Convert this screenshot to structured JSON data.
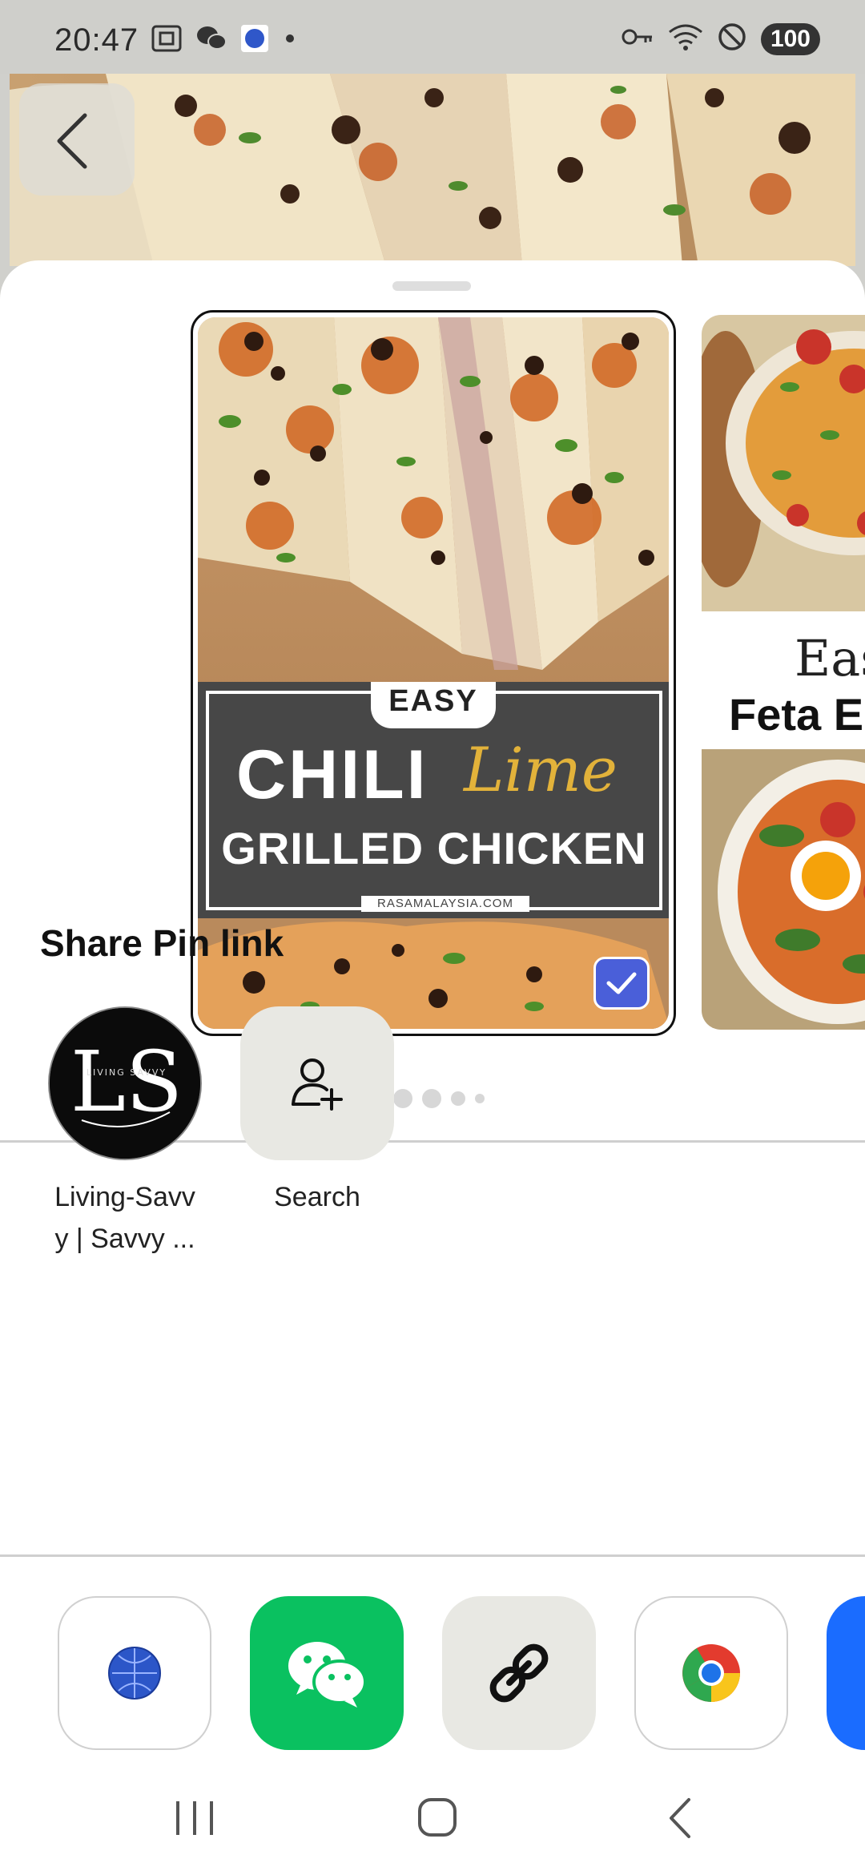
{
  "status_bar": {
    "time": "20:47",
    "battery": "100",
    "left_icons": [
      "screenshot-icon",
      "wechat-icon",
      "app-icon",
      "dot-icon"
    ],
    "right_icons": [
      "key-icon",
      "wifi-icon",
      "dnd-icon"
    ]
  },
  "pin": {
    "badge": "EASY",
    "title_line1": "CHILI",
    "title_script": "Lime",
    "title_line2": "GRILLED CHICKEN",
    "source": "RASAMALAYSIA.COM",
    "selected": true
  },
  "next_pin": {
    "title_top": "Eas",
    "title_bottom": "Feta E"
  },
  "pagination": {
    "total": 5,
    "active": 0
  },
  "share": {
    "title": "Share Pin link",
    "contacts": [
      {
        "label": "Living-Savv\ny | Savvy ...",
        "avatar_text": "LS",
        "avatar_subtext": "LIVING SAVVY"
      },
      {
        "label": "Search",
        "icon": "add-person-icon"
      }
    ]
  },
  "apps": [
    {
      "name": "browser-app",
      "icon": "globe-icon",
      "bg": "#ffffff"
    },
    {
      "name": "wechat",
      "icon": "wechat-icon",
      "bg": "#07c160"
    },
    {
      "name": "copy-link",
      "icon": "link-icon",
      "bg": "#e8e8e3"
    },
    {
      "name": "chrome",
      "icon": "chrome-icon",
      "bg": "#ffffff"
    },
    {
      "name": "more-app",
      "icon": "blue-app-icon",
      "bg": "#1a6cff"
    }
  ],
  "colors": {
    "accent_check": "#4a5fd9",
    "wechat_green": "#0ac160",
    "pin_banner": "#474747"
  }
}
